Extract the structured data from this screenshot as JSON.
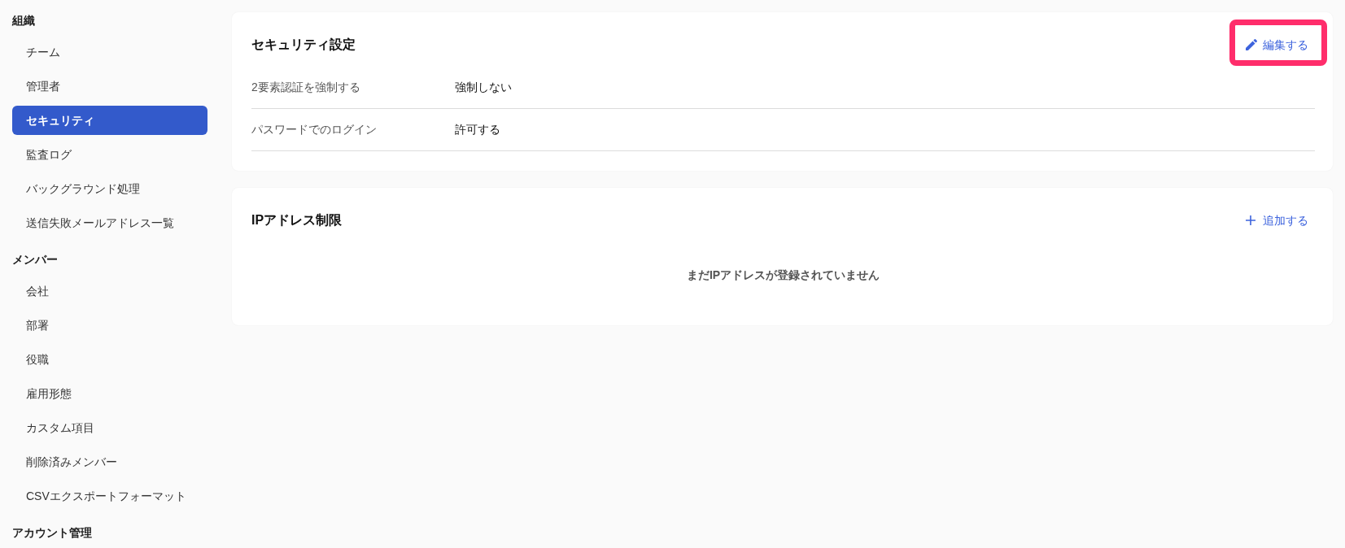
{
  "sidebar": {
    "sections": [
      {
        "heading": "組織",
        "items": [
          {
            "label": "チーム",
            "selected": false
          },
          {
            "label": "管理者",
            "selected": false
          },
          {
            "label": "セキュリティ",
            "selected": true
          },
          {
            "label": "監査ログ",
            "selected": false
          },
          {
            "label": "バックグラウンド処理",
            "selected": false
          },
          {
            "label": "送信失敗メールアドレス一覧",
            "selected": false
          }
        ]
      },
      {
        "heading": "メンバー",
        "items": [
          {
            "label": "会社",
            "selected": false
          },
          {
            "label": "部署",
            "selected": false
          },
          {
            "label": "役職",
            "selected": false
          },
          {
            "label": "雇用形態",
            "selected": false
          },
          {
            "label": "カスタム項目",
            "selected": false
          },
          {
            "label": "削除済みメンバー",
            "selected": false
          },
          {
            "label": "CSVエクスポートフォーマット",
            "selected": false
          }
        ]
      },
      {
        "heading": "アカウント管理"
      }
    ]
  },
  "security_settings": {
    "title": "セキュリティ設定",
    "edit_button": {
      "label": "編集する",
      "highlighted": true
    },
    "rows": [
      {
        "label": "2要素認証を強制する",
        "value": "強制しない"
      },
      {
        "label": "パスワードでのログイン",
        "value": "許可する"
      }
    ]
  },
  "ip_restriction": {
    "title": "IPアドレス制限",
    "add_button": {
      "label": "追加する"
    },
    "empty_message": "まだIPアドレスが登録されていません"
  }
}
